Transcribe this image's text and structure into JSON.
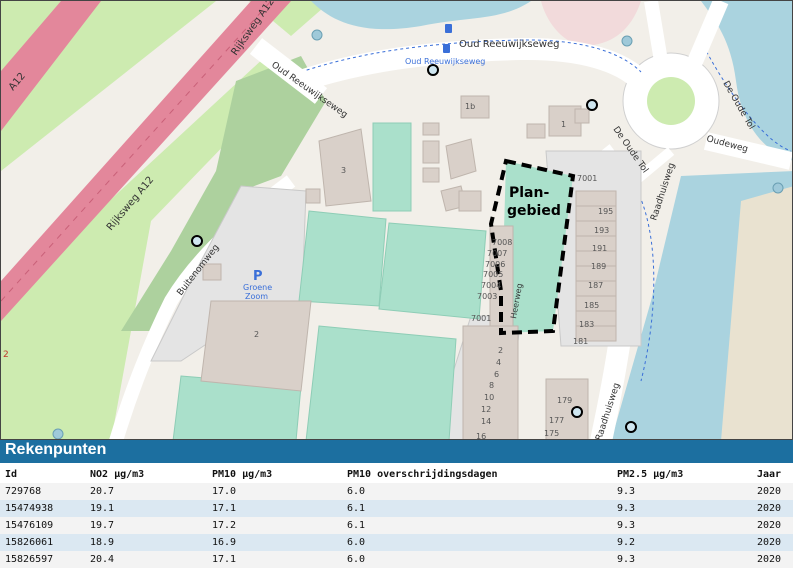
{
  "map": {
    "labels": {
      "road_a12_1": "Rijksweg A12",
      "road_a12_2": "Rijksweg A12",
      "road_a12_3": "A12",
      "a12_shield": "2",
      "oud_reeuwijkseweg_1": "Oud Reeuwijkseweg",
      "oud_reeuwijkseweg_2": "Oud Reeuwijkseweg",
      "busstop_name": "Oud Reeuwijkseweg",
      "buitenomweg": "Buitenomweg",
      "de_oude_tol": "De Oude Tol",
      "oudeweg": "Oudeweg",
      "de_oude_tol_2": "De Oude Tol",
      "raadhuisweg_1": "Raadhuisweg",
      "raadhuisweg_2": "Raadhuisweg",
      "parking_symbol": "P",
      "parking_name_1": "Groene",
      "parking_name_2": "Zoom",
      "plangebied_1": "Plan-",
      "plangebied_2": "gebied",
      "street_small": "Heerweg"
    },
    "building_numbers": [
      "1b",
      "1",
      "3",
      "2",
      "7008",
      "7007",
      "7006",
      "7005",
      "7004",
      "7003",
      "7001",
      "7001",
      "195",
      "193",
      "191",
      "189",
      "187",
      "185",
      "183",
      "181",
      "2",
      "4",
      "6",
      "8",
      "10",
      "12",
      "14",
      "16",
      "179",
      "177",
      "175"
    ]
  },
  "panel": {
    "title": "Rekenpunten"
  },
  "table": {
    "columns": [
      "Id",
      "NO2 µg/m3",
      "PM10 µg/m3",
      "PM10 overschrijdingsdagen",
      "PM2.5 µg/m3",
      "Jaar"
    ],
    "rows": [
      [
        "729768",
        "20.7",
        "17.0",
        "6.0",
        "9.3",
        "2020"
      ],
      [
        "15474938",
        "19.1",
        "17.1",
        "6.1",
        "9.3",
        "2020"
      ],
      [
        "15476109",
        "19.7",
        "17.2",
        "6.1",
        "9.3",
        "2020"
      ],
      [
        "15826061",
        "18.9",
        "16.9",
        "6.0",
        "9.2",
        "2020"
      ],
      [
        "15826597",
        "20.4",
        "17.1",
        "6.0",
        "9.3",
        "2020"
      ]
    ]
  },
  "colors": {
    "header": "#1c6fa0",
    "row_odd": "#f3f3f3",
    "row_even": "#dbe8f2",
    "motorway": "#e3879b",
    "grass": "#cdebb0",
    "pitch": "#aae0cb",
    "water": "#aad3df"
  }
}
